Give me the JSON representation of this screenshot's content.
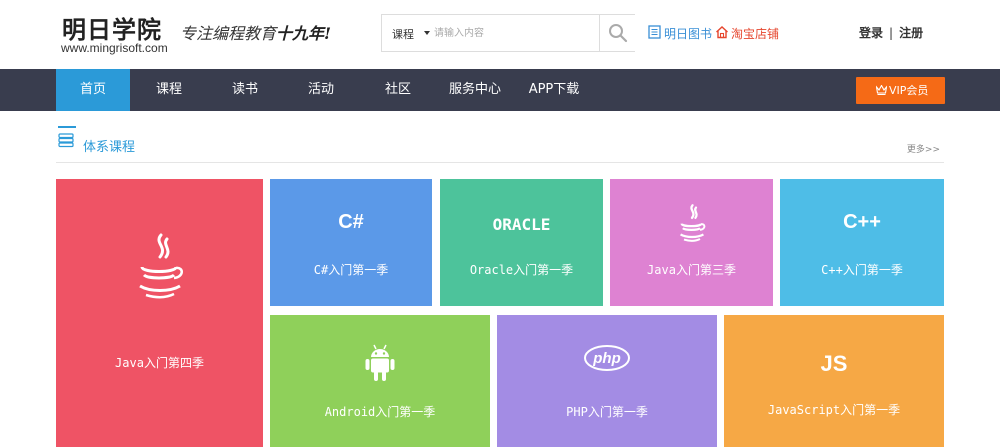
{
  "header": {
    "logo_title": "明日学院",
    "logo_url": "www.mingrisoft.com",
    "slogan_a": "专注编程教育",
    "slogan_b": "十九年!",
    "search": {
      "category": "课程",
      "placeholder": "请输入内容"
    },
    "links": {
      "book": "明日图书",
      "taobao": "淘宝店铺"
    },
    "login": "登录",
    "separator": "|",
    "register": "注册"
  },
  "nav": {
    "items": [
      {
        "label": "首页",
        "active": true
      },
      {
        "label": "课程",
        "active": false
      },
      {
        "label": "读书",
        "active": false
      },
      {
        "label": "活动",
        "active": false
      },
      {
        "label": "社区",
        "active": false
      },
      {
        "label": "服务中心",
        "active": false
      },
      {
        "label": "APP下载",
        "active": false
      }
    ],
    "vip_label": "VIP会员"
  },
  "section": {
    "title": "体系课程",
    "more": "更多>>"
  },
  "courses": [
    {
      "id": "java4",
      "label": "Java入门第四季",
      "icon": "java-icon",
      "color": "#ef5365"
    },
    {
      "id": "cs",
      "label": "C#入门第一季",
      "icon": "csharp-icon",
      "icon_text": "C#",
      "color": "#5b99e8"
    },
    {
      "id": "oracle",
      "label": "Oracle入门第一季",
      "icon": "oracle-icon",
      "icon_text": "ORACLE",
      "color": "#4dc39b"
    },
    {
      "id": "java3",
      "label": "Java入门第三季",
      "icon": "java-icon",
      "color": "#de82d2"
    },
    {
      "id": "cpp",
      "label": "C++入门第一季",
      "icon": "cpp-icon",
      "icon_text": "C++",
      "color": "#4ebde7"
    },
    {
      "id": "android",
      "label": "Android入门第一季",
      "icon": "android-icon",
      "color": "#8fd05a"
    },
    {
      "id": "php",
      "label": "PHP入门第一季",
      "icon": "php-icon",
      "icon_text": "php",
      "color": "#a38ce4"
    },
    {
      "id": "js",
      "label": "JavaScript入门第一季",
      "icon": "js-icon",
      "icon_text": "JS",
      "color": "#f6a845"
    }
  ]
}
